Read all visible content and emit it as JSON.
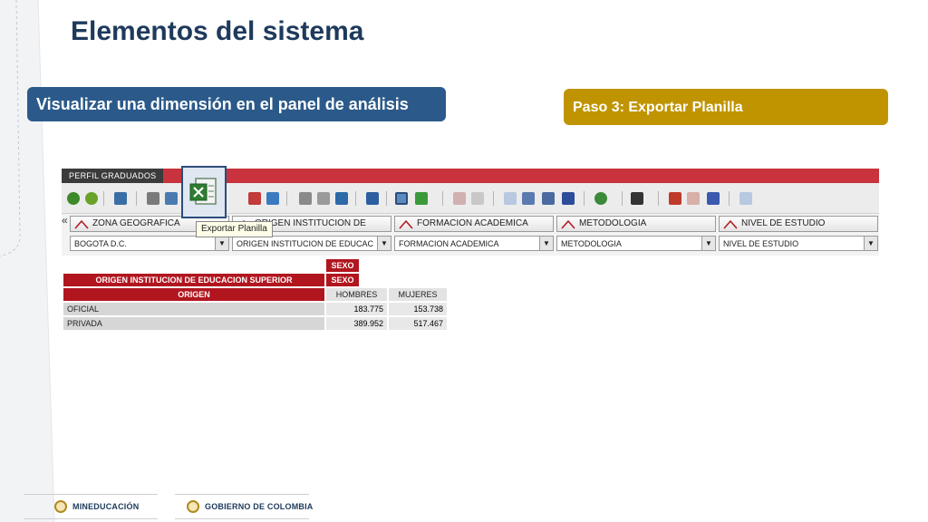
{
  "slide": {
    "title": "Elementos del sistema",
    "section_label": "Visualizar una dimensión en el panel de análisis",
    "step_label": "Paso 3: Exportar Planilla"
  },
  "app": {
    "tab_label": "PERFIL GRADUADOS",
    "tooltip": "Exportar Planilla",
    "export_icon": "excel-export-icon",
    "collapse_glyph": "«",
    "dimensions": [
      {
        "header": "ZONA GEOGRAFICA",
        "selected": "BOGOTA D.C."
      },
      {
        "header": "ORIGEN INSTITUCION DE",
        "selected": "ORIGEN INSTITUCION DE EDUCAC"
      },
      {
        "header": "FORMACION ACADEMICA",
        "selected": "FORMACION ACADEMICA"
      },
      {
        "header": "METODOLOGIA",
        "selected": "METODOLOGIA"
      },
      {
        "header": "NIVEL DE ESTUDIO",
        "selected": "NIVEL DE ESTUDIO"
      }
    ]
  },
  "pivot": {
    "col_dim_1": "SEXO",
    "col_dim_2": "SEXO",
    "row_dim_title": "ORIGEN INSTITUCION DE EDUCACION SUPERIOR",
    "row_header": "ORIGEN",
    "columns": [
      "HOMBRES",
      "MUJERES"
    ],
    "rows": [
      {
        "label": "OFICIAL",
        "values": [
          "183.775",
          "153.738"
        ]
      },
      {
        "label": "PRIVADA",
        "values": [
          "389.952",
          "517.467"
        ]
      }
    ]
  },
  "footer": {
    "left_logo_text": "MINEDUCACIÓN",
    "right_logo_text": "GOBIERNO DE COLOMBIA"
  },
  "colors": {
    "title": "#1e3a5c",
    "blue_pill": "#2b5a8a",
    "gold_pill": "#c09400",
    "header_red": "#c8333d",
    "table_red": "#b1161f"
  }
}
